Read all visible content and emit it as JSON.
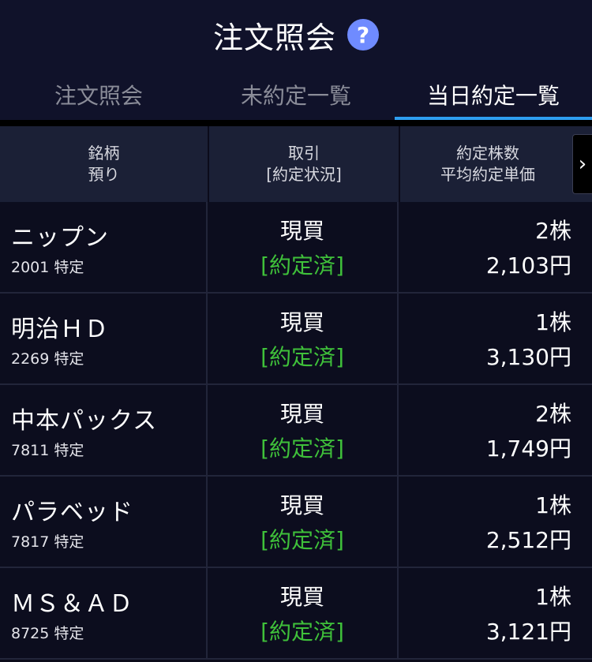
{
  "header": {
    "title": "注文照会",
    "help_icon": "?"
  },
  "tabs": [
    {
      "label": "注文照会",
      "active": false
    },
    {
      "label": "未約定一覧",
      "active": false
    },
    {
      "label": "当日約定一覧",
      "active": true
    }
  ],
  "table": {
    "headers": [
      {
        "line1": "銘柄",
        "line2": "預り"
      },
      {
        "line1": "取引",
        "line2": "[約定状況]"
      },
      {
        "line1": "約定株数",
        "line2": "平均約定単価"
      }
    ],
    "scroll_icon": "›",
    "rows": [
      {
        "name": "ニップン",
        "code": "2001 特定",
        "trade": "現買",
        "status": "[約定済]",
        "qty": "2株",
        "price": "2,103円"
      },
      {
        "name": "明治ＨＤ",
        "code": "2269 特定",
        "trade": "現買",
        "status": "[約定済]",
        "qty": "1株",
        "price": "3,130円"
      },
      {
        "name": "中本パックス",
        "code": "7811 特定",
        "trade": "現買",
        "status": "[約定済]",
        "qty": "2株",
        "price": "1,749円"
      },
      {
        "name": "パラベッド",
        "code": "7817 特定",
        "trade": "現買",
        "status": "[約定済]",
        "qty": "1株",
        "price": "2,512円"
      },
      {
        "name": "ＭＳ＆ＡＤ",
        "code": "8725 特定",
        "trade": "現買",
        "status": "[約定済]",
        "qty": "1株",
        "price": "3,121円"
      }
    ]
  },
  "colors": {
    "accent": "#2e9ef0",
    "status_green": "#3fc03a",
    "help": "#6f8bff"
  }
}
